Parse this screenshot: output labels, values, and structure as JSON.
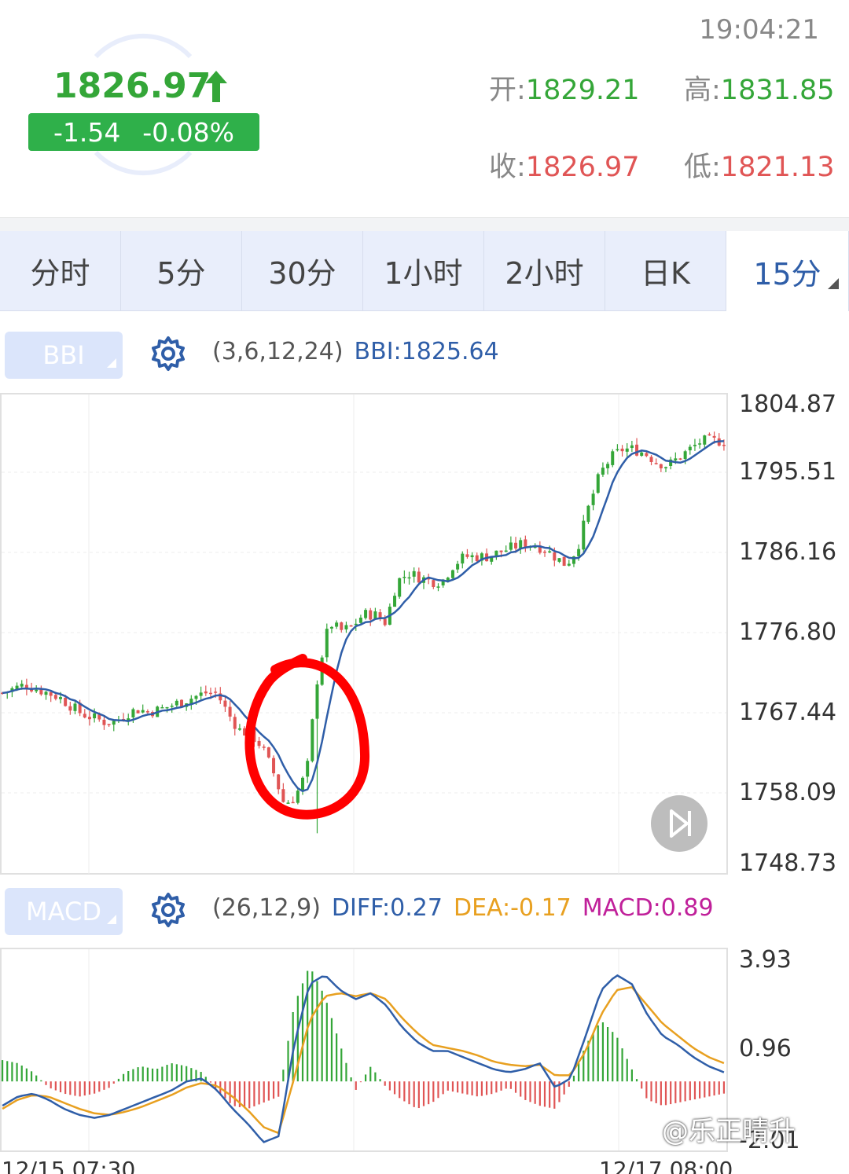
{
  "quote": {
    "price": "1826.97",
    "change": "-1.54",
    "change_pct": "-0.08%",
    "time": "19:04:21",
    "open_label": "开:",
    "open": "1829.21",
    "high_label": "高:",
    "high": "1831.85",
    "close_label": "收:",
    "close": "1826.97",
    "low_label": "低:",
    "low": "1821.13"
  },
  "tabs": [
    {
      "label": "分时"
    },
    {
      "label": "5分"
    },
    {
      "label": "30分"
    },
    {
      "label": "1小时"
    },
    {
      "label": "2小时"
    },
    {
      "label": "日K"
    },
    {
      "label": "15分",
      "active": true
    }
  ],
  "bbi": {
    "button": "BBI",
    "params": "(3,6,12,24)",
    "value": "BBI:1825.64",
    "y_ticks": [
      "1804.87",
      "1795.51",
      "1786.16",
      "1776.80",
      "1767.44",
      "1758.09",
      "1748.73"
    ]
  },
  "macd": {
    "button": "MACD",
    "params": "(26,12,9)",
    "diff": "DIFF:0.27",
    "dea": "DEA:-0.17",
    "macd": "MACD:0.89",
    "y_ticks": [
      "3.93",
      "0.96",
      "-2.01"
    ]
  },
  "dates": [
    "12/15 07:30",
    "12/17 08:00"
  ],
  "watermark": "@乐正晴升",
  "colors": {
    "up": "#34a638",
    "down": "#e05555",
    "bbi": "#2f5ea8",
    "dea": "#e8a020",
    "macd": "#c0209a",
    "annotation": "#ff0000"
  },
  "chart_data": [
    {
      "type": "candlestick",
      "title": "BBI",
      "ylim": [
        1748.73,
        1804.87
      ],
      "price_path": [
        1769.5,
        1770,
        1770.5,
        1770,
        1769.5,
        1769,
        1768,
        1767,
        1766.5,
        1766,
        1766,
        1767,
        1767.5,
        1767.2,
        1767.5,
        1768,
        1768.5,
        1769,
        1769.5,
        1769.5,
        1767,
        1765,
        1764.5,
        1763,
        1760,
        1756,
        1757,
        1760,
        1772,
        1778,
        1777,
        1777.5,
        1779,
        1779,
        1778,
        1783,
        1784,
        1783.5,
        1783,
        1783,
        1785,
        1786,
        1786,
        1786,
        1786.5,
        1787,
        1787.5,
        1787.5,
        1787,
        1786,
        1785,
        1787,
        1792,
        1796,
        1798,
        1799,
        1799,
        1798.5,
        1797.5,
        1797,
        1798,
        1799,
        1800,
        1800,
        1800
      ]
    },
    {
      "type": "bar",
      "title": "MACD",
      "ylim": [
        -2.01,
        3.93
      ],
      "diff": [
        -0.8,
        -0.5,
        -0.4,
        -0.6,
        -0.9,
        -1.1,
        -1.2,
        -1.1,
        -0.9,
        -0.7,
        -0.5,
        -0.3,
        0,
        0.1,
        -0.3,
        -0.9,
        -1.4,
        -2.0,
        -1.8,
        1.2,
        3.2,
        3.5,
        3.0,
        2.7,
        2.9,
        2.5,
        1.8,
        1.3,
        1.0,
        1.0,
        0.8,
        0.6,
        0.4,
        0.3,
        0.4,
        0.6,
        -0.2,
        0.1,
        1.5,
        3.0,
        3.5,
        3.2,
        2.2,
        1.5,
        1.2,
        0.8,
        0.5,
        0.3
      ],
      "dea": [
        -0.9,
        -0.6,
        -0.45,
        -0.5,
        -0.7,
        -0.9,
        -1.05,
        -1.1,
        -1.0,
        -0.85,
        -0.65,
        -0.45,
        -0.2,
        -0.05,
        -0.15,
        -0.5,
        -0.95,
        -1.5,
        -1.7,
        0.1,
        2.0,
        2.8,
        2.9,
        2.8,
        2.9,
        2.7,
        2.1,
        1.6,
        1.2,
        1.1,
        1.0,
        0.85,
        0.65,
        0.55,
        0.5,
        0.55,
        0.2,
        0.2,
        1.0,
        2.2,
        3.0,
        3.1,
        2.5,
        1.9,
        1.5,
        1.1,
        0.8,
        0.6
      ],
      "macd": [
        0.7,
        0.6,
        0.3,
        -0.2,
        -0.4,
        -0.5,
        -0.4,
        -0.2,
        0.3,
        0.5,
        0.4,
        0.6,
        0.5,
        0.3,
        -0.3,
        -0.8,
        -0.9,
        -0.7,
        -0.5,
        2.5,
        3.8,
        2.8,
        1.2,
        -0.3,
        0.5,
        -0.2,
        -0.6,
        -0.9,
        -0.7,
        -0.3,
        -0.4,
        -0.5,
        -0.4,
        -0.2,
        -0.6,
        -0.8,
        -0.9,
        -0.1,
        1.2,
        2.0,
        1.5,
        0.4,
        -0.6,
        -0.8,
        -0.7,
        -0.6,
        -0.5,
        -0.4
      ]
    }
  ]
}
